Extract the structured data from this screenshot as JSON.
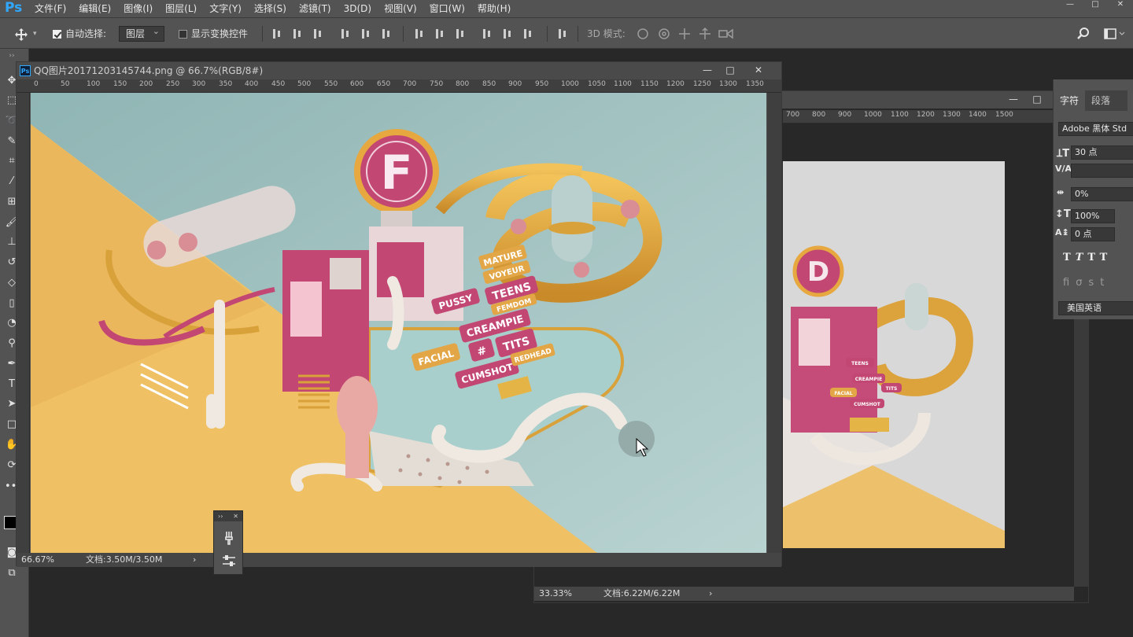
{
  "app": {
    "logo": "Ps"
  },
  "menu": [
    "文件(F)",
    "编辑(E)",
    "图像(I)",
    "图层(L)",
    "文字(Y)",
    "选择(S)",
    "滤镜(T)",
    "3D(D)",
    "视图(V)",
    "窗口(W)",
    "帮助(H)"
  ],
  "window_controls": {
    "minimize": "—",
    "maximize": "□",
    "close": "✕"
  },
  "options": {
    "auto_select_label": "自动选择:",
    "auto_select_checked": true,
    "auto_select_target": "图层",
    "show_transform_label": "显示变换控件",
    "show_transform_checked": false,
    "mode_3d_label": "3D 模式:"
  },
  "doc1": {
    "title": "QQ图片20171203145744.png @ 66.7%(RGB/8#)",
    "ruler_ticks": [
      "0",
      "50",
      "100",
      "150",
      "200",
      "250",
      "300",
      "350",
      "400",
      "450",
      "500",
      "550",
      "600",
      "650",
      "700",
      "750",
      "800",
      "850",
      "900",
      "950",
      "1000",
      "1050",
      "1100",
      "1150",
      "1200",
      "1250",
      "1300",
      "1350"
    ],
    "zoom": "66.67%",
    "doc_size": "文档:3.50M/3.50M"
  },
  "doc2": {
    "ruler_ticks": [
      "700",
      "800",
      "900",
      "1000",
      "1100",
      "1200",
      "1300",
      "1400",
      "1500"
    ],
    "zoom": "33.33%",
    "doc_size": "文档:6.22M/6.22M"
  },
  "char_panel": {
    "tabs": [
      "字符",
      "段落"
    ],
    "font_family": "Adobe 黑体 Std",
    "font_size": "30 点",
    "kerning": "",
    "tracking": "0%",
    "vertical_scale": "100%",
    "baseline_shift": "0 点",
    "language": "美国英语"
  },
  "canvas_art": {
    "signs": [
      "MATURE",
      "VOYEUR",
      "TEENS",
      "FEMDOM",
      "PUSSY",
      "CREAMPIE",
      "FACIAL",
      "#",
      "TITS",
      "CUMSHOT",
      "REDHEAD"
    ],
    "letter_main": "F",
    "letter_small": "D",
    "signs_small": [
      "TEENS",
      "FACIAL",
      "CREAMPIE",
      "TITS",
      "CUMSHOT"
    ]
  },
  "colors": {
    "chrome": "#535353",
    "workspace": "#282828",
    "accent": "#31a8ff",
    "art_teal": "#a7c8c6",
    "art_yellow": "#eec063",
    "art_pink": "#c24773",
    "art_gold": "#d9a13a"
  },
  "icons": [
    "move-icon",
    "search-icon",
    "workspace-icon",
    "align-top-icon",
    "align-vcenter-icon",
    "align-bottom-icon",
    "align-left-icon",
    "align-hcenter-icon",
    "align-right-icon",
    "distribute-icon",
    "3d-rotate-icon",
    "3d-roll-icon",
    "3d-pan-icon",
    "3d-slide-icon",
    "3d-scale-icon",
    "brush-icon",
    "settings-icon"
  ]
}
